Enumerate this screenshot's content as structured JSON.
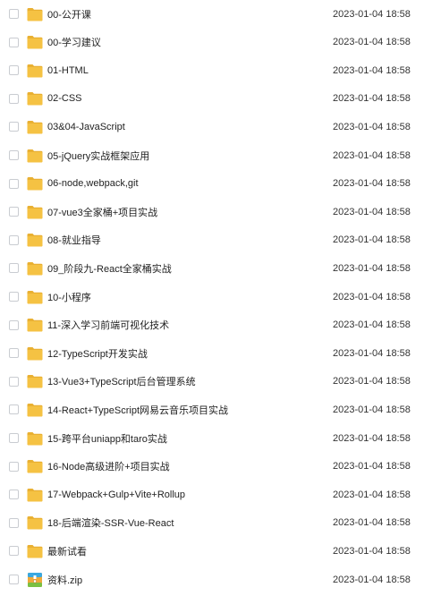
{
  "files": [
    {
      "name": "00-公开课",
      "date": "2023-01-04 18:58",
      "type": "folder"
    },
    {
      "name": "00-学习建议",
      "date": "2023-01-04 18:58",
      "type": "folder"
    },
    {
      "name": "01-HTML",
      "date": "2023-01-04 18:58",
      "type": "folder"
    },
    {
      "name": "02-CSS",
      "date": "2023-01-04 18:58",
      "type": "folder"
    },
    {
      "name": "03&04-JavaScript",
      "date": "2023-01-04 18:58",
      "type": "folder"
    },
    {
      "name": "05-jQuery实战框架应用",
      "date": "2023-01-04 18:58",
      "type": "folder"
    },
    {
      "name": "06-node,webpack,git",
      "date": "2023-01-04 18:58",
      "type": "folder"
    },
    {
      "name": "07-vue3全家桶+项目实战",
      "date": "2023-01-04 18:58",
      "type": "folder"
    },
    {
      "name": "08-就业指导",
      "date": "2023-01-04 18:58",
      "type": "folder"
    },
    {
      "name": "09_阶段九-React全家桶实战",
      "date": "2023-01-04 18:58",
      "type": "folder"
    },
    {
      "name": "10-小程序",
      "date": "2023-01-04 18:58",
      "type": "folder"
    },
    {
      "name": "11-深入学习前端可视化技术",
      "date": "2023-01-04 18:58",
      "type": "folder"
    },
    {
      "name": "12-TypeScript开发实战",
      "date": "2023-01-04 18:58",
      "type": "folder"
    },
    {
      "name": "13-Vue3+TypeScript后台管理系统",
      "date": "2023-01-04 18:58",
      "type": "folder"
    },
    {
      "name": "14-React+TypeScript网易云音乐项目实战",
      "date": "2023-01-04 18:58",
      "type": "folder"
    },
    {
      "name": "15-跨平台uniapp和taro实战",
      "date": "2023-01-04 18:58",
      "type": "folder"
    },
    {
      "name": "16-Node高级进阶+项目实战",
      "date": "2023-01-04 18:58",
      "type": "folder"
    },
    {
      "name": "17-Webpack+Gulp+Vite+Rollup",
      "date": "2023-01-04 18:58",
      "type": "folder"
    },
    {
      "name": "18-后端渲染-SSR-Vue-React",
      "date": "2023-01-04 18:58",
      "type": "folder"
    },
    {
      "name": "最新试看",
      "date": "2023-01-04 18:58",
      "type": "folder"
    },
    {
      "name": "资料.zip",
      "date": "2023-01-04 18:58",
      "type": "zip"
    }
  ],
  "colors": {
    "folder": "#f5c243",
    "folder_tab": "#e9b032",
    "zip_bg": "#f0a93a",
    "zip_band": "#3aa8e0",
    "zip_stripe": "#7bc043"
  }
}
